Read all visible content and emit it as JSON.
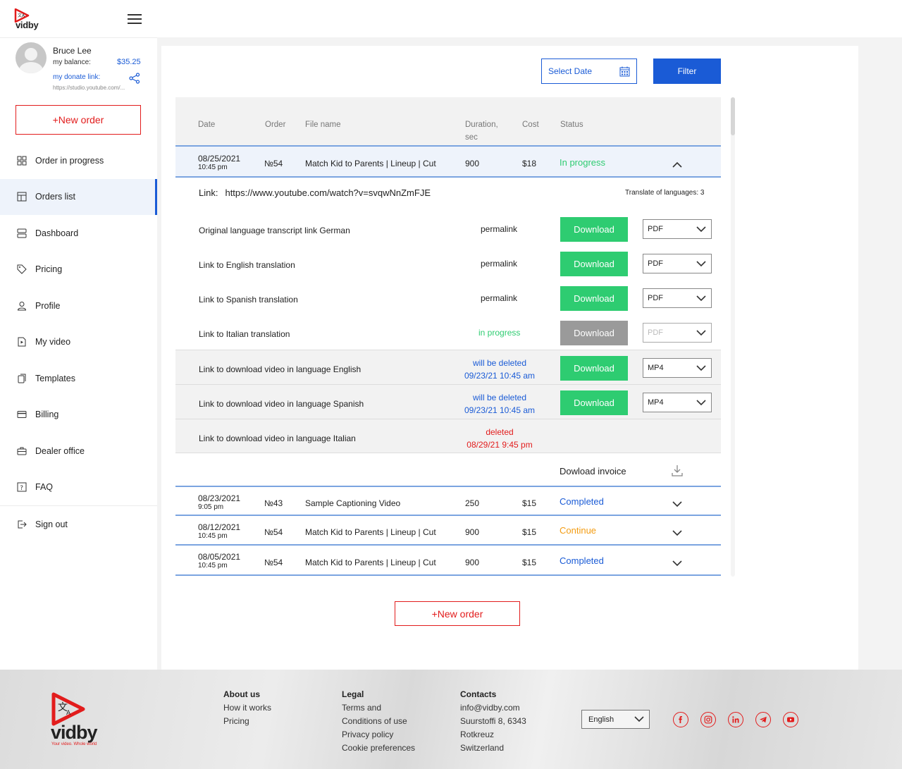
{
  "brand": {
    "name": "vidby",
    "tagline": "Your video. Whole world",
    "accent": "#e21c1c",
    "primary": "#1a5bd6",
    "success": "#2ecc71"
  },
  "user": {
    "name": "Bruce Lee",
    "balance_label": "my balance:",
    "balance": "$35.25",
    "donate_label": "my donate link:",
    "donate_url": "https://studio.youtube.com/..."
  },
  "sidebar": {
    "new_order": "+New order",
    "items": [
      {
        "label": "Order in progress",
        "icon": "grid-icon"
      },
      {
        "label": "Orders list",
        "icon": "list-icon",
        "active": true
      },
      {
        "label": "Dashboard",
        "icon": "dashboard-icon"
      },
      {
        "label": "Pricing",
        "icon": "tag-icon"
      },
      {
        "label": "Profile",
        "icon": "user-icon"
      },
      {
        "label": "My video",
        "icon": "video-file-icon"
      },
      {
        "label": "Templates",
        "icon": "copy-icon"
      },
      {
        "label": "Billing",
        "icon": "card-icon"
      },
      {
        "label": "Dealer office",
        "icon": "briefcase-icon"
      },
      {
        "label": "FAQ",
        "icon": "question-icon"
      },
      {
        "label": "Sign out",
        "icon": "signout-icon"
      }
    ]
  },
  "toolbar": {
    "select_date": "Select Date",
    "filter": "Filter"
  },
  "table": {
    "headers": {
      "date": "Date",
      "order": "Order",
      "file": "File name",
      "duration": "Duration,",
      "duration_unit": "sec",
      "cost": "Cost",
      "status": "Status"
    },
    "expanded_row": {
      "date": "08/25/2021",
      "time": "10:45 pm",
      "order": "№54",
      "file": "Match Kid to Parents | Lineup | Cut",
      "duration": "900",
      "cost": "$18",
      "status": "In progress"
    },
    "link_label": "Link:",
    "link_url": "https://www.youtube.com/watch?v=svqwNnZmFJE",
    "translate_count": "Translate of languages: 3",
    "sub_rows": [
      {
        "label": "Original language transcript link German",
        "mid": "permalink",
        "button": "Download",
        "format": "PDF"
      },
      {
        "label": "Link to English translation",
        "mid": "permalink",
        "button": "Download",
        "format": "PDF"
      },
      {
        "label": "Link to Spanish translation",
        "mid": "permalink",
        "button": "Download",
        "format": "PDF"
      },
      {
        "label": "Link to Italian translation",
        "mid": "in progress",
        "button": "Download",
        "format": "PDF"
      },
      {
        "label": "Link to download video in language English",
        "mid": "will be deleted",
        "mid2": "09/23/21  10:45 am",
        "button": "Download",
        "format": "MP4"
      },
      {
        "label": "Link to download video in language Spanish",
        "mid": "will be deleted",
        "mid2": "09/23/21  10:45 am",
        "button": "Download",
        "format": "MP4"
      },
      {
        "label": "Link to download video in language Italian",
        "mid": "deleted",
        "mid2": "08/29/21  9:45 pm"
      }
    ],
    "invoice": "Dowload invoice",
    "rows": [
      {
        "date": "08/23/2021",
        "time": "9:05 pm",
        "order": "№43",
        "file": "Sample Captioning Video",
        "duration": "250",
        "cost": "$15",
        "status": "Completed"
      },
      {
        "date": "08/12/2021",
        "time": "10:45 pm",
        "order": "№54",
        "file": "Match Kid to Parents | Lineup | Cut",
        "duration": "900",
        "cost": "$15",
        "status": "Continue"
      },
      {
        "date": "08/05/2021",
        "time": "10:45 pm",
        "order": "№54",
        "file": "Match Kid to Parents | Lineup | Cut",
        "duration": "900",
        "cost": "$15",
        "status": "Completed"
      }
    ]
  },
  "main": {
    "new_order": "+New order"
  },
  "footer": {
    "about": {
      "title": "About us",
      "links": [
        "How it works",
        "Pricing"
      ]
    },
    "legal": {
      "title": "Legal",
      "links": [
        "Terms and",
        "Conditions of use",
        "Privacy policy",
        "Cookie preferences"
      ]
    },
    "contacts": {
      "title": "Contacts",
      "lines": [
        "info@vidby.com",
        "Suurstoffi 8, 6343",
        "Rotkreuz",
        "Switzerland"
      ]
    },
    "language": "English",
    "social": [
      "facebook-icon",
      "instagram-icon",
      "linkedin-icon",
      "telegram-icon",
      "youtube-icon"
    ]
  }
}
